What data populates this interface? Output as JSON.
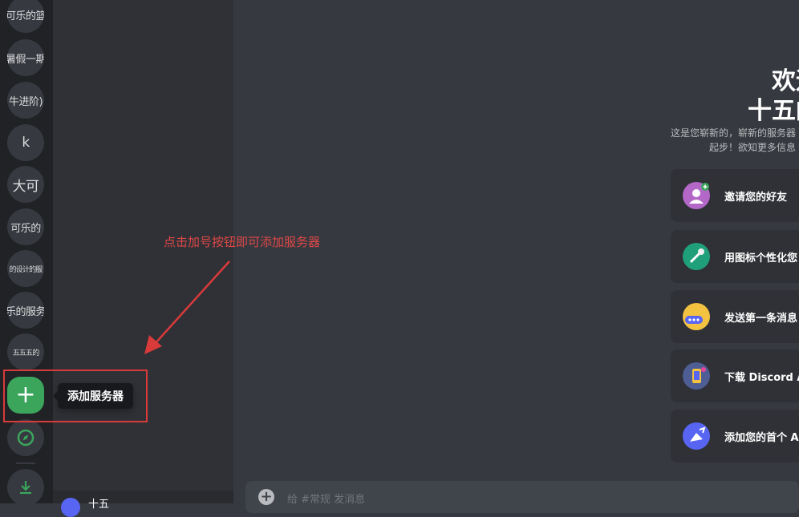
{
  "servers": [
    {
      "label": "可乐的篮"
    },
    {
      "label": "暑假一期"
    },
    {
      "label": "牛进阶)"
    },
    {
      "label": "k"
    },
    {
      "label": "大可"
    },
    {
      "label": "可乐的"
    },
    {
      "label": "的设计的服"
    },
    {
      "label": "乐的服务"
    },
    {
      "label": "五五五的"
    }
  ],
  "add_server": {
    "symbol": "+",
    "tooltip": "添加服务器"
  },
  "annotation": {
    "text": "点击加号按钮即可添加服务器",
    "color": "#d93a3a"
  },
  "user": {
    "name": "十五"
  },
  "welcome": {
    "title_line1": "欢迎",
    "title_line2": "十五的",
    "desc_line1": "这是您崭新的，崭新的服务器",
    "desc_line2": "起步！欲知更多信息"
  },
  "cards": [
    {
      "label": "邀请您的好友",
      "icon": "invite-friends-icon",
      "color": "#b368c8"
    },
    {
      "label": "用图标个性化您",
      "icon": "personalize-icon",
      "color": "#1fa07a"
    },
    {
      "label": "发送第一条消息",
      "icon": "first-message-icon",
      "color": "#f3c241"
    },
    {
      "label": "下载 Discord AP",
      "icon": "download-app-icon",
      "color": "#4e5d94"
    },
    {
      "label": "添加您的首个 A",
      "icon": "add-app-icon",
      "color": "#5865f2"
    }
  ],
  "message_bar": {
    "placeholder": "给 #常规 发消息"
  },
  "colors": {
    "accent": "#3ba55c",
    "rail": "#202225",
    "sidebar": "#2f3136",
    "main": "#36393f"
  }
}
